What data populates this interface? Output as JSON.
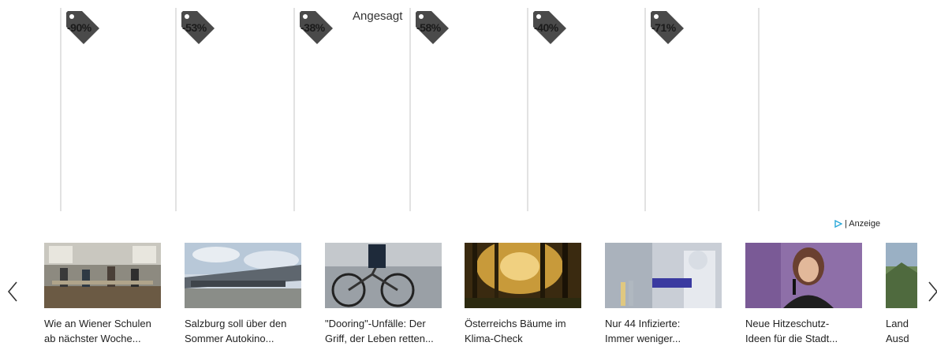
{
  "deals": {
    "header": "Angesagt",
    "cards": [
      {
        "discount": "-90%"
      },
      {
        "discount": "-53%"
      },
      {
        "discount": "-38%"
      },
      {
        "discount": "-58%"
      },
      {
        "discount": "-40%"
      },
      {
        "discount": "-71%"
      }
    ],
    "ad_label": "| Anzeige"
  },
  "news": {
    "items": [
      {
        "line1": "Wie an Wiener Schulen",
        "line2": "ab nächster Woche..."
      },
      {
        "line1": "Salzburg soll über den",
        "line2": "Sommer Autokino..."
      },
      {
        "line1": "\"Dooring\"-Unfälle: Der",
        "line2": "Griff, der Leben retten..."
      },
      {
        "line1": "Österreichs Bäume im",
        "line2": "Klima-Check"
      },
      {
        "line1": "Nur 44 Infizierte:",
        "line2": "Immer weniger..."
      },
      {
        "line1": "Neue Hitzeschutz-",
        "line2": "Ideen für die Stadt..."
      },
      {
        "line1": "Land",
        "line2": "Ausd"
      }
    ]
  },
  "colors": {
    "tag": "#4a4a4a",
    "divider": "#e2e2e2",
    "ad_icon": "#2aa8d8"
  }
}
